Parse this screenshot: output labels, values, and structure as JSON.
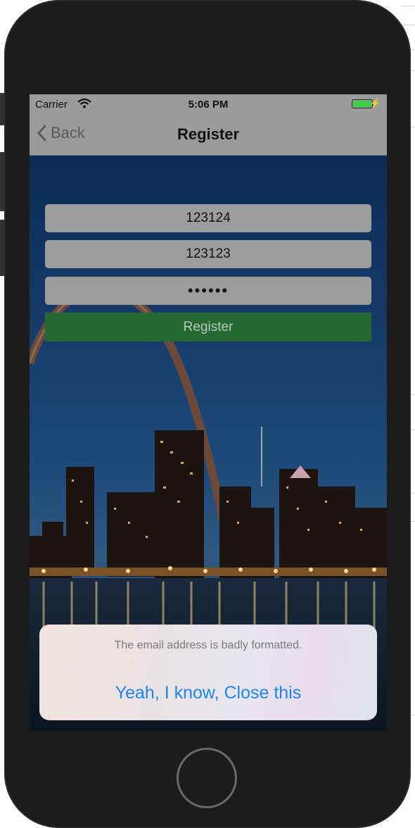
{
  "status_bar": {
    "carrier": "Carrier",
    "time": "5:06 PM",
    "battery_color": "#3ecf4a"
  },
  "nav": {
    "back_label": "Back",
    "title": "Register"
  },
  "form": {
    "field1_value": "123124",
    "field2_value": "123123",
    "password_value": "••••••",
    "register_label": "Register",
    "register_color": "#256a35"
  },
  "alert": {
    "message": "The email address is badly formatted.",
    "button_label": "Yeah, I know, Close this",
    "button_color": "#1f86e6"
  },
  "icons": [
    "wifi-icon",
    "battery-icon",
    "charging-bolt-icon",
    "chevron-left-icon"
  ]
}
